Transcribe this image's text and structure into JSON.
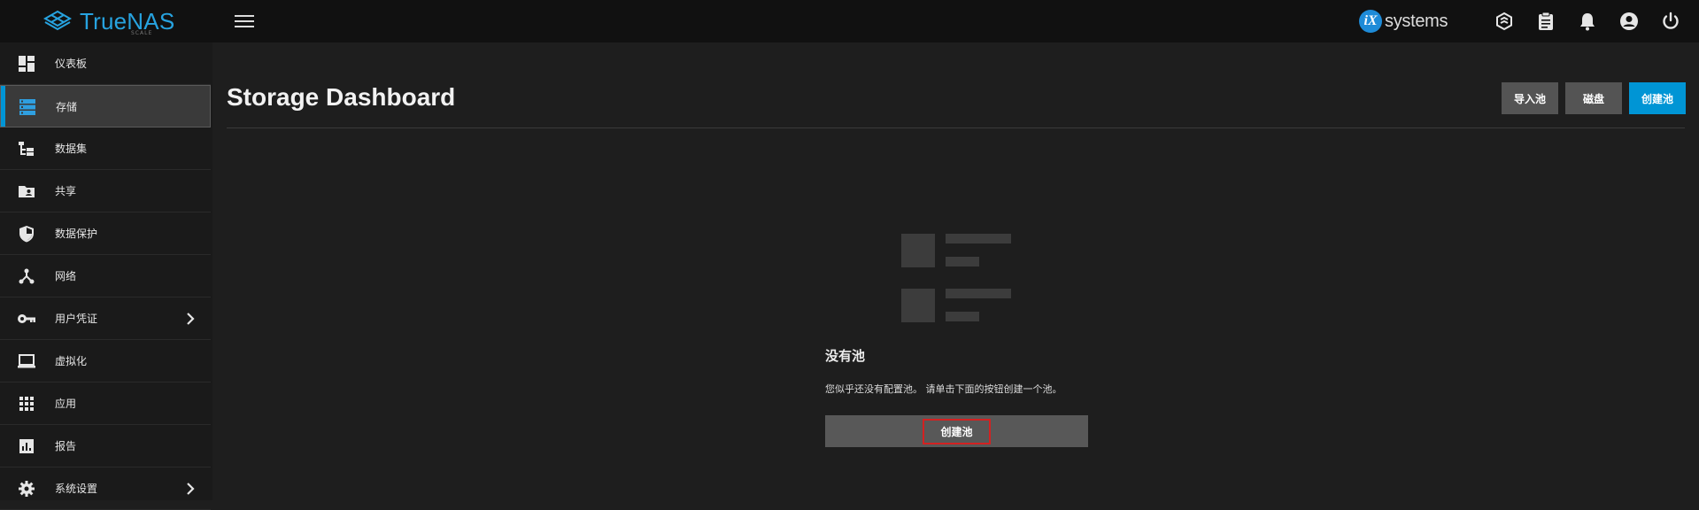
{
  "header": {
    "logo_text": "TrueNAS",
    "logo_sub": "SCALE",
    "brand_circle": "iX",
    "brand_text": "systems",
    "icons": [
      "truecommand-icon",
      "clipboard-icon",
      "bell-icon",
      "account-icon",
      "power-icon"
    ]
  },
  "sidebar": {
    "items": [
      {
        "label": "仪表板",
        "icon": "dashboard-icon"
      },
      {
        "label": "存储",
        "icon": "storage-icon",
        "active": true
      },
      {
        "label": "数据集",
        "icon": "datasets-icon"
      },
      {
        "label": "共享",
        "icon": "shares-icon"
      },
      {
        "label": "数据保护",
        "icon": "shield-icon"
      },
      {
        "label": "网络",
        "icon": "network-icon"
      },
      {
        "label": "用户凭证",
        "icon": "key-icon",
        "expandable": true
      },
      {
        "label": "虚拟化",
        "icon": "laptop-icon"
      },
      {
        "label": "应用",
        "icon": "apps-grid-icon"
      },
      {
        "label": "报告",
        "icon": "reports-icon"
      },
      {
        "label": "系统设置",
        "icon": "gear-icon",
        "expandable": true
      }
    ]
  },
  "main": {
    "title": "Storage Dashboard",
    "actions": {
      "import_pool": "导入池",
      "disks": "磁盘",
      "create_pool": "创建池"
    },
    "empty_state": {
      "title": "没有池",
      "message": "您似乎还没有配置池。 请单击下面的按钮创建一个池。",
      "button": "创建池"
    }
  },
  "colors": {
    "accent": "#0095d5",
    "topbar_bg": "#111111",
    "sidebar_bg": "#1a1a1a",
    "content_bg": "#1e1e1e",
    "highlight_border": "#d32121"
  }
}
